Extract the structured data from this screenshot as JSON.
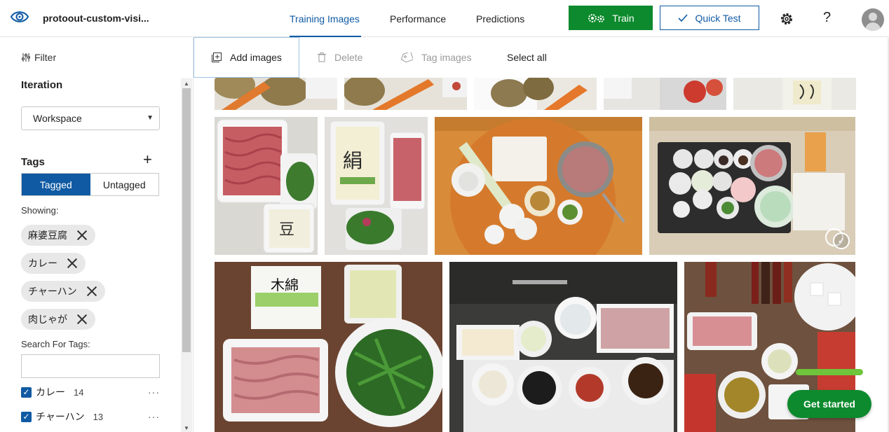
{
  "header": {
    "project_name": "protoout-custom-visi...",
    "tabs": [
      {
        "label": "Training Images",
        "active": true
      },
      {
        "label": "Performance",
        "active": false
      },
      {
        "label": "Predictions",
        "active": false
      }
    ],
    "train_label": "Train",
    "quick_test_label": "Quick Test",
    "help_label": "?"
  },
  "sidebar": {
    "filter_label": "Filter",
    "iteration_title": "Iteration",
    "iteration_value": "Workspace",
    "tags_title": "Tags",
    "tagged_label": "Tagged",
    "untagged_label": "Untagged",
    "showing_label": "Showing:",
    "chips": [
      "麻婆豆腐",
      "カレー",
      "チャーハン",
      "肉じゃが"
    ],
    "search_label": "Search For Tags:",
    "search_value": "",
    "tag_list": [
      {
        "name": "カレー",
        "count": "14",
        "checked": true
      },
      {
        "name": "チャーハン",
        "count": "13",
        "checked": true
      }
    ],
    "more_label": "···"
  },
  "toolbar": {
    "add_images": "Add images",
    "delete": "Delete",
    "tag_images": "Tag images",
    "select_all": "Select all"
  },
  "gallery": {
    "images": [
      {
        "name": "curry-ingredients-1",
        "selected": false
      },
      {
        "name": "curry-ingredients-2",
        "selected": false
      },
      {
        "name": "curry-ingredients-3",
        "selected": false
      },
      {
        "name": "tomato-ingredients",
        "selected": false
      },
      {
        "name": "tofu-partial",
        "selected": false
      },
      {
        "name": "mince-tofu-chives",
        "selected": false
      },
      {
        "name": "tofu-mince-tray",
        "selected": false
      },
      {
        "name": "mapo-ingredients-board",
        "selected": false
      },
      {
        "name": "mapo-ingredients-tray",
        "selected": true
      },
      {
        "name": "tofu-mince-chives-table",
        "selected": false
      },
      {
        "name": "ingredients-on-sink",
        "selected": false
      },
      {
        "name": "mince-tofu-sauces",
        "selected": false
      }
    ]
  },
  "floating": {
    "get_started_label": "Get started"
  },
  "colors": {
    "accent_blue": "#0f5aa3",
    "train_green": "#0d8a2d",
    "progress_green": "#6ec43b"
  },
  "icons": [
    "eye-logo-icon",
    "gear-icon",
    "help-icon",
    "filter-icon",
    "plus-icon",
    "add-image-icon",
    "trash-icon",
    "tag-icon",
    "check-icon",
    "close-icon"
  ]
}
